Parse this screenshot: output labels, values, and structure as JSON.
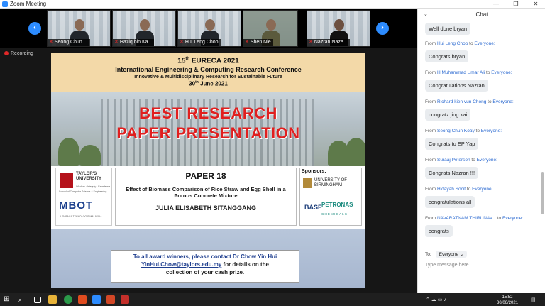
{
  "window": {
    "title": "Zoom Meeting",
    "controls": [
      "—",
      "❐",
      "✕"
    ]
  },
  "participants": [
    {
      "name": "Seong Chun ..."
    },
    {
      "name": "Haziq bin Ka..."
    },
    {
      "name": "Hui Leng Choo"
    },
    {
      "name": "Shen Nie"
    },
    {
      "name": "Nazran Naze..."
    }
  ],
  "nav": {
    "prev": "‹",
    "next": "›"
  },
  "recording": "Recording",
  "slide": {
    "edition": "15",
    "edition_suffix": "th",
    "event": "EURECA 2021",
    "conference": "International Engineering & Computing Research Conference",
    "theme": "Innovative & Multidisciplinary Research for Sustainable Future",
    "date_day": "30",
    "date_suffix": "th",
    "date_rest": " June 2021",
    "best_line1": "BEST RESEARCH",
    "best_line2": "PAPER PRESENTATION",
    "taylors_name": "TAYLOR'S UNIVERSITY",
    "taylors_tag": "Wisdom · Integrity · Excellence",
    "taylors_school": "School of Computer Science & Engineering",
    "mbot": "MBOT",
    "mbot_sub": "LEMBAGA TEKNOLOGIS MALAYSIA",
    "paper_no": "PAPER 18",
    "paper_title": "Effect of Biomass Comparison of Rice Straw and Egg Shell in a Porous Concrete Mixture",
    "author": "JULIA ELISABETH SITANGGANG",
    "sponsors_label": "Sponsors:",
    "uob": "UNIVERSITY OF BIRMINGHAM",
    "basf": "BASF",
    "petronas": "PETRONAS",
    "chemicals": "CHEMICALS",
    "notice_line1": "To all award winners, please contact Dr Chow Yin Hui",
    "notice_email": "YinHui.Chow@taylors.edu.my",
    "notice_line2": " for details on the",
    "notice_line3": "collection of your cash prize."
  },
  "chat": {
    "title": "Chat",
    "to_word": "to",
    "everyone": "Everyone:",
    "messages": [
      {
        "from": "",
        "text": "Well done bryan"
      },
      {
        "from": "Hui Leng Choo",
        "text": "Congrats bryan"
      },
      {
        "from": "H Muhammad Umar Ali",
        "text": "Congratulations Nazran"
      },
      {
        "from": "Richard kien vun Chong",
        "text": "congratz jing kai"
      },
      {
        "from": "Seong Chun Koay",
        "text": "Congrats to EP Yap"
      },
      {
        "from": "Suraaj Peterson",
        "text": "Congrats Nazran !!!"
      },
      {
        "from": "Hidayah Socit",
        "text": "congratulations all"
      },
      {
        "from": "NAVARATNAM THIRUNAV...",
        "text": "congrats"
      }
    ],
    "from_word": "From",
    "to_label": "To:",
    "to_value": "Everyone",
    "placeholder": "Type message here..."
  },
  "taskbar": {
    "time": "15:52",
    "date": "30/06/2021"
  }
}
